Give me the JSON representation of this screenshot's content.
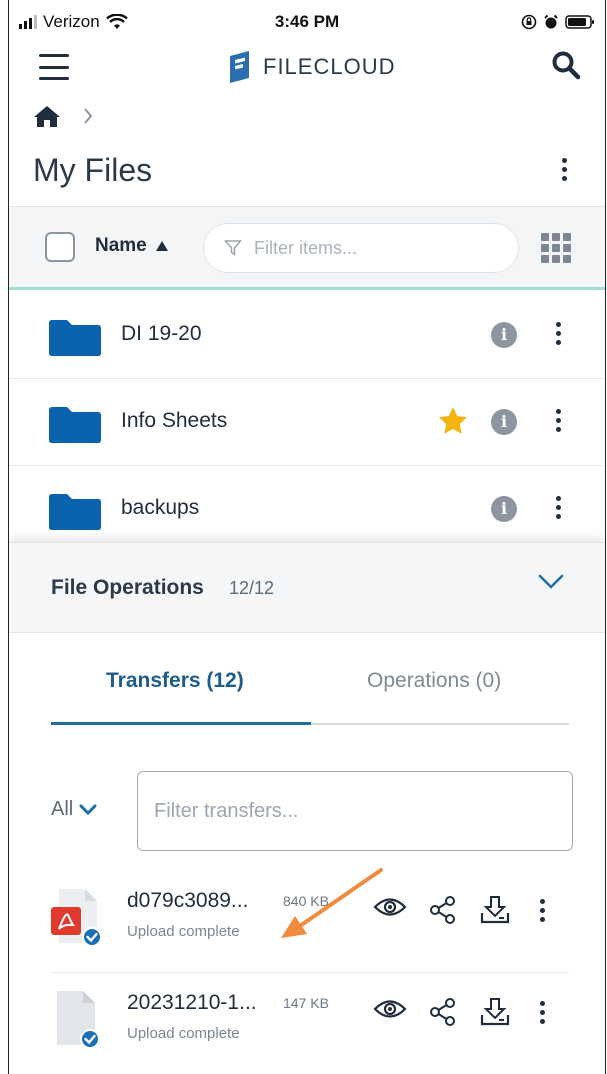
{
  "status_bar": {
    "carrier": "Verizon",
    "time": "3:46 PM"
  },
  "header": {
    "logo_text": "FILECLOUD"
  },
  "page": {
    "title": "My Files"
  },
  "list_header": {
    "sort_label": "Name",
    "filter_placeholder": "Filter items..."
  },
  "folders": [
    {
      "name": "DI 19-20",
      "starred": false
    },
    {
      "name": "Info Sheets",
      "starred": true
    },
    {
      "name": "backups",
      "starred": false
    }
  ],
  "file_operations": {
    "title": "File Operations",
    "count": "12/12",
    "tabs": {
      "transfers": "Transfers (12)",
      "operations": "Operations (0)"
    },
    "filter_all": "All",
    "filter_placeholder": "Filter transfers...",
    "transfers": [
      {
        "name": "d079c3089...",
        "size": "840 KB",
        "status": "Upload complete",
        "type": "pdf"
      },
      {
        "name": "20231210-1...",
        "size": "147 KB",
        "status": "Upload complete",
        "type": "file"
      }
    ]
  },
  "colors": {
    "folder": "#0b63b0",
    "accent": "#1f6ea5",
    "star": "#f5b30f",
    "arrow": "#f08a3c"
  }
}
